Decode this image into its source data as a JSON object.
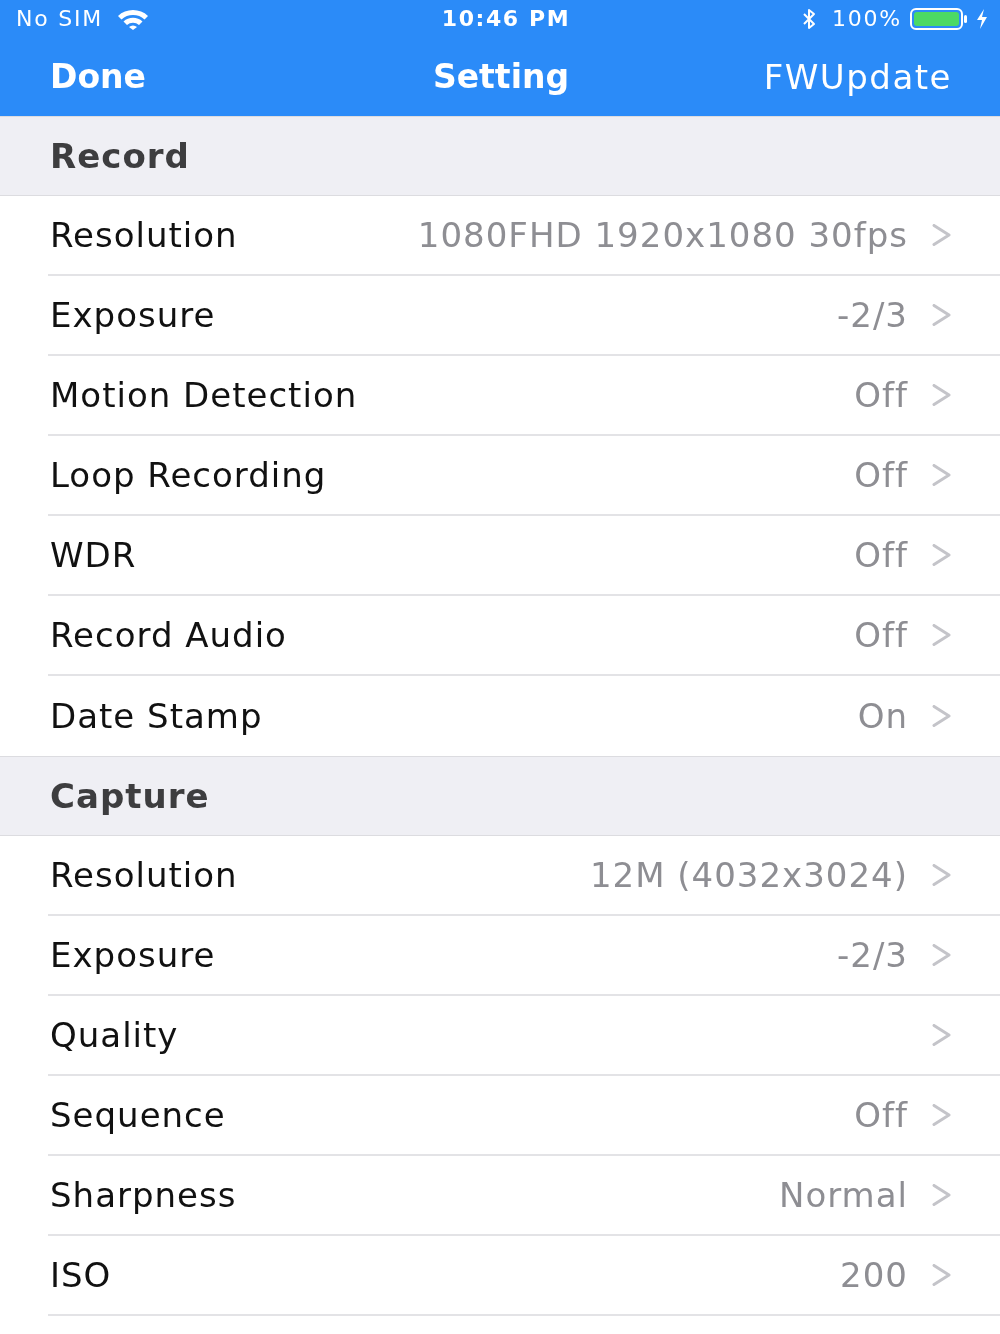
{
  "status_bar": {
    "carrier": "No SIM",
    "time": "10:46 PM",
    "battery": "100%"
  },
  "nav_bar": {
    "left_button": "Done",
    "title": "Setting",
    "right_button": "FWUpdate"
  },
  "sections": [
    {
      "header": "Record",
      "rows": [
        {
          "label": "Resolution",
          "value": "1080FHD 1920x1080 30fps"
        },
        {
          "label": "Exposure",
          "value": "-2/3"
        },
        {
          "label": "Motion Detection",
          "value": "Off"
        },
        {
          "label": "Loop Recording",
          "value": "Off"
        },
        {
          "label": "WDR",
          "value": "Off"
        },
        {
          "label": "Record Audio",
          "value": "Off"
        },
        {
          "label": "Date Stamp",
          "value": "On"
        }
      ]
    },
    {
      "header": "Capture",
      "rows": [
        {
          "label": "Resolution",
          "value": "12M (4032x3024)"
        },
        {
          "label": "Exposure",
          "value": "-2/3"
        },
        {
          "label": "Quality"
        },
        {
          "label": "Sequence",
          "value": "Off"
        },
        {
          "label": "Sharpness",
          "value": "Normal"
        },
        {
          "label": "ISO",
          "value": "200"
        }
      ]
    }
  ]
}
